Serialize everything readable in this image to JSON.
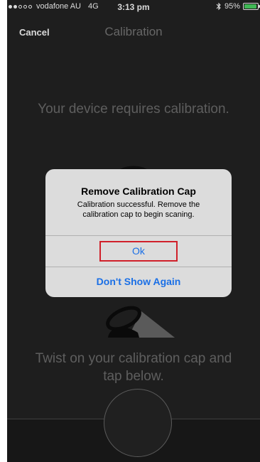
{
  "status_bar": {
    "signal_filled": 2,
    "signal_total": 5,
    "carrier": "vodafone AU",
    "network": "4G",
    "time": "3:13 pm",
    "bluetooth_icon": "bluetooth-icon",
    "battery_text": "95%",
    "battery_level": 0.95,
    "battery_color": "#4cd964"
  },
  "nav": {
    "cancel_label": "Cancel",
    "title": "Calibration"
  },
  "main": {
    "requires_text": "Your device requires calibration.",
    "twist_text_line1": "Twist on your calibration cap and",
    "twist_text_line2": "tap below."
  },
  "alert": {
    "title": "Remove Calibration Cap",
    "message_line1": "Calibration successful. Remove the",
    "message_line2": "calibration cap to begin scaning.",
    "ok_label": "Ok",
    "dont_show_label": "Don't Show Again",
    "highlight_color": "#d0202a",
    "button_color": "#1a6fe6"
  }
}
